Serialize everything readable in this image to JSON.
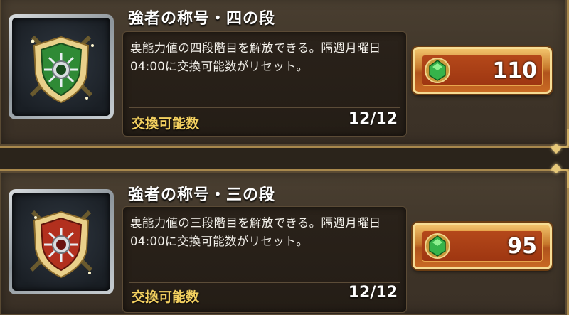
{
  "items": [
    {
      "title": "強者の称号・四の段",
      "description": "裏能力値の四段階目を解放できる。隔週月曜日04:00に交換可能数がリセット。",
      "exchange_label": "交換可能数",
      "exchange_value": "12/12",
      "price": "110",
      "emblem_color": "#2f8a35",
      "icon": "green-shield-emblem-icon"
    },
    {
      "title": "強者の称号・三の段",
      "description": "裏能力値の三段階目を解放できる。隔週月曜日04:00に交換可能数がリセット。",
      "exchange_label": "交換可能数",
      "exchange_value": "12/12",
      "price": "95",
      "emblem_color": "#b2301e",
      "icon": "red-shield-emblem-icon"
    }
  ],
  "currency_icon": "green-gem-icon"
}
